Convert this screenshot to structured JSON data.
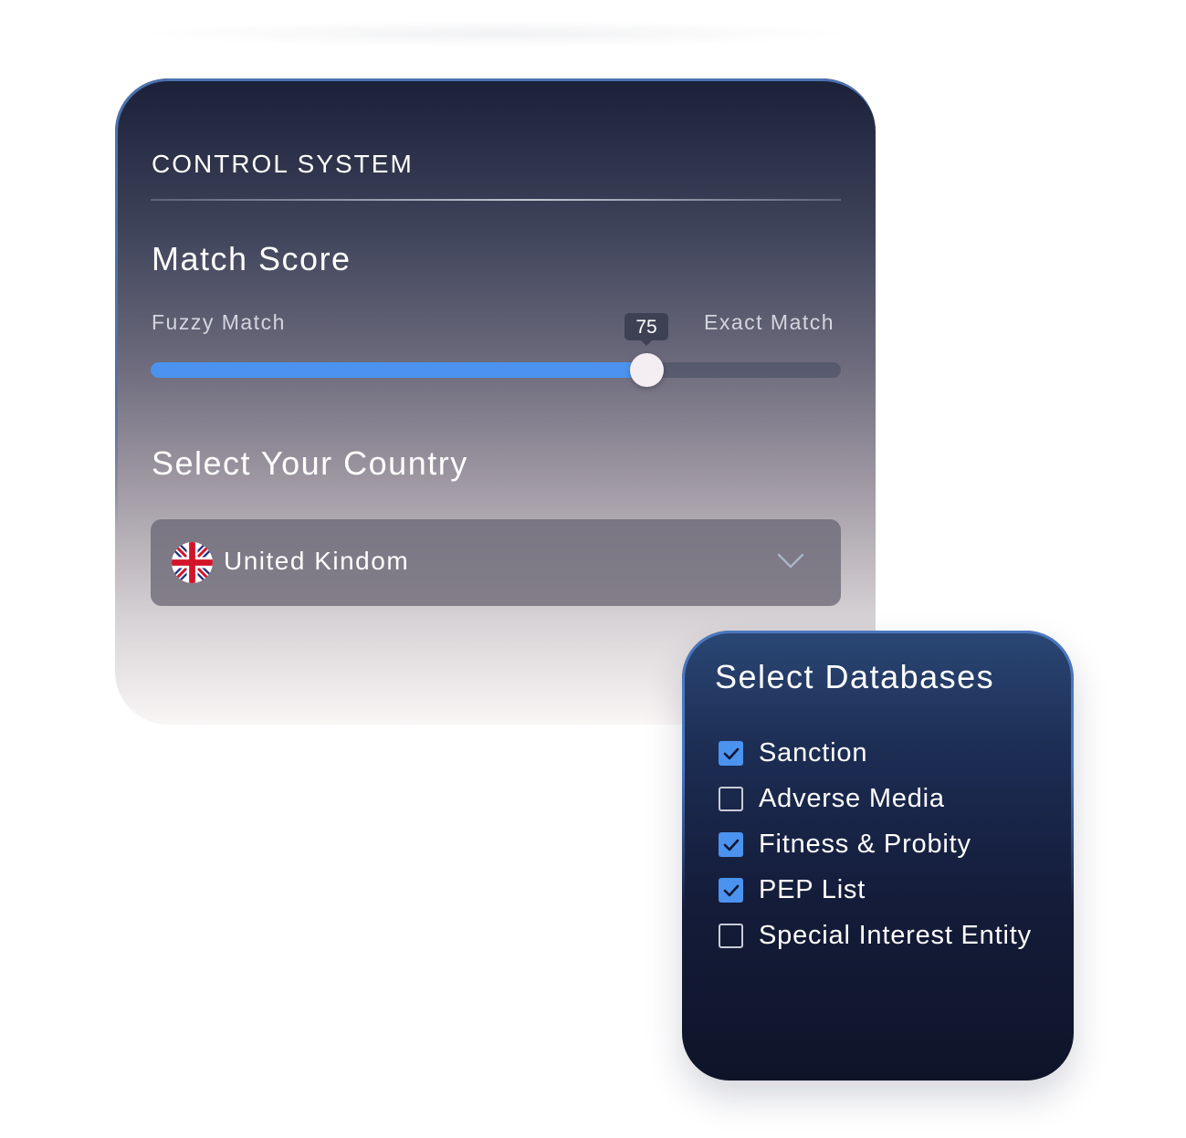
{
  "control_panel": {
    "title": "CONTROL SYSTEM",
    "match_score": {
      "heading": "Match Score",
      "min_label": "Fuzzy Match",
      "max_label": "Exact Match",
      "value": 75,
      "value_label": "75"
    },
    "country": {
      "heading": "Select Your Country",
      "selected": "United Kindom",
      "flag_icon": "uk-flag-icon",
      "dropdown_icon": "chevron-down-icon"
    }
  },
  "databases": {
    "title": "Select Databases",
    "items": [
      {
        "label": "Sanction",
        "checked": true
      },
      {
        "label": "Adverse Media",
        "checked": false
      },
      {
        "label": "Fitness & Probity",
        "checked": true
      },
      {
        "label": "PEP List",
        "checked": true
      },
      {
        "label": "Special Interest Entity",
        "checked": false
      }
    ]
  },
  "colors": {
    "accent": "#4b93ee",
    "panel_top": "#1a2038",
    "db_panel": "#141c3a"
  }
}
